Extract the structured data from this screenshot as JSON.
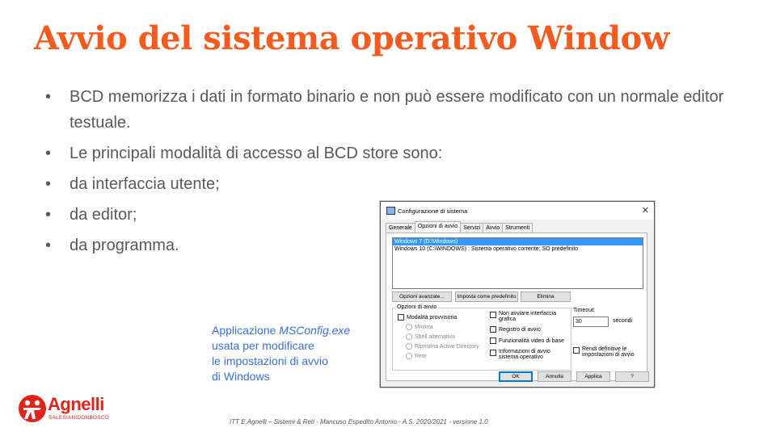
{
  "title": "Avvio del sistema operativo Window",
  "bullets": [
    "BCD memorizza i dati in formato binario e non può essere modificato con un normale editor testuale.",
    "Le principali modalità di accesso al BCD store sono:",
    "da interfaccia utente;",
    "da editor;",
    "da programma."
  ],
  "bullet_symbol": "•",
  "caption": {
    "line1_prefix": "Applicazione ",
    "line1_italic": "MSConfig.exe",
    "line2": "usata per modificare",
    "line3": "le impostazioni di avvio",
    "line4": "di Windows"
  },
  "dialog": {
    "title": "Configurazione di sistema",
    "close_glyph": "✕",
    "tabs": [
      "Generale",
      "Opzioni di avvio",
      "Servizi",
      "Avvio",
      "Strumenti"
    ],
    "boot_entries": [
      "Windows 7 (D:\\Windows)",
      "Windows 10 (C:\\WINDOWS) : Sistema operativo corrente; SO predefinito"
    ],
    "buttons_row": [
      "Opzioni avanzate...",
      "Imposta come predefinito",
      "Elimina"
    ],
    "boot_options_legend": "Opzioni di avvio",
    "safe_boot_label": "Modalità provvisoria",
    "safe_boot_radios": [
      "Minima",
      "Shell alternativa",
      "Ripristina Active Directory",
      "Rete"
    ],
    "right_checks": [
      "Non avviare interfaccia grafica",
      "Registro di avvio",
      "Funzionalità video di base",
      "Informazioni di avvio sistema operativo"
    ],
    "timeout_label": "Timeout:",
    "timeout_value": "30",
    "timeout_unit": "secondi",
    "permanent_label": "Rendi definitive le impostazioni di avvio",
    "bottom_buttons": [
      "OK",
      "Annulla",
      "Applica",
      "?"
    ]
  },
  "logo": {
    "brand": "Agnelli",
    "sub": "SALESIANIDONBOSCO"
  },
  "footer": "ITT E.Agnelli – Sistemi & Reti - Mancuso Espedito Antonio - A.S. 2020/2021 - versione 1.0",
  "colors": {
    "title": "#f55a1e",
    "body_text": "#595959",
    "caption": "#3a6fd8",
    "brand_red": "#e2231a",
    "selection": "#3399ff"
  }
}
